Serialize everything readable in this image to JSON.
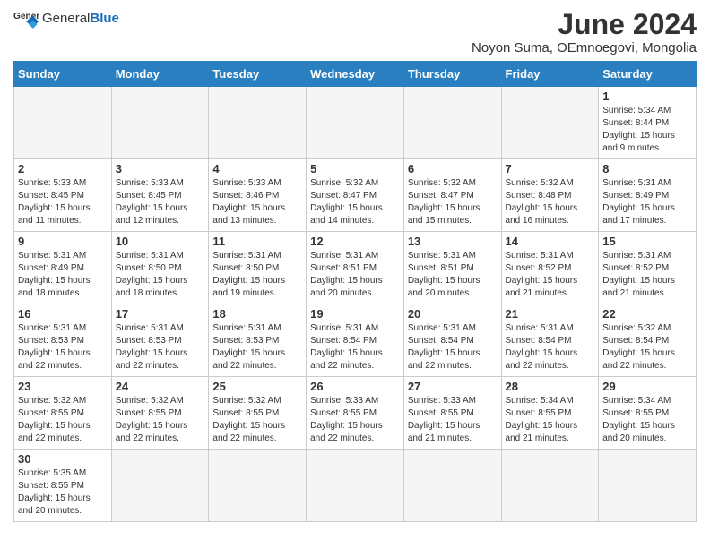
{
  "logo": {
    "text_general": "General",
    "text_blue": "Blue"
  },
  "title": "June 2024",
  "location": "Noyon Suma, OEmnoegovi, Mongolia",
  "weekdays": [
    "Sunday",
    "Monday",
    "Tuesday",
    "Wednesday",
    "Thursday",
    "Friday",
    "Saturday"
  ],
  "weeks": [
    [
      {
        "day": "",
        "info": ""
      },
      {
        "day": "",
        "info": ""
      },
      {
        "day": "",
        "info": ""
      },
      {
        "day": "",
        "info": ""
      },
      {
        "day": "",
        "info": ""
      },
      {
        "day": "",
        "info": ""
      },
      {
        "day": "1",
        "info": "Sunrise: 5:34 AM\nSunset: 8:44 PM\nDaylight: 15 hours and 9 minutes."
      }
    ],
    [
      {
        "day": "2",
        "info": "Sunrise: 5:33 AM\nSunset: 8:45 PM\nDaylight: 15 hours and 11 minutes."
      },
      {
        "day": "3",
        "info": "Sunrise: 5:33 AM\nSunset: 8:45 PM\nDaylight: 15 hours and 12 minutes."
      },
      {
        "day": "4",
        "info": "Sunrise: 5:33 AM\nSunset: 8:46 PM\nDaylight: 15 hours and 13 minutes."
      },
      {
        "day": "5",
        "info": "Sunrise: 5:32 AM\nSunset: 8:47 PM\nDaylight: 15 hours and 14 minutes."
      },
      {
        "day": "6",
        "info": "Sunrise: 5:32 AM\nSunset: 8:47 PM\nDaylight: 15 hours and 15 minutes."
      },
      {
        "day": "7",
        "info": "Sunrise: 5:32 AM\nSunset: 8:48 PM\nDaylight: 15 hours and 16 minutes."
      },
      {
        "day": "8",
        "info": "Sunrise: 5:31 AM\nSunset: 8:49 PM\nDaylight: 15 hours and 17 minutes."
      }
    ],
    [
      {
        "day": "9",
        "info": "Sunrise: 5:31 AM\nSunset: 8:49 PM\nDaylight: 15 hours and 18 minutes."
      },
      {
        "day": "10",
        "info": "Sunrise: 5:31 AM\nSunset: 8:50 PM\nDaylight: 15 hours and 18 minutes."
      },
      {
        "day": "11",
        "info": "Sunrise: 5:31 AM\nSunset: 8:50 PM\nDaylight: 15 hours and 19 minutes."
      },
      {
        "day": "12",
        "info": "Sunrise: 5:31 AM\nSunset: 8:51 PM\nDaylight: 15 hours and 20 minutes."
      },
      {
        "day": "13",
        "info": "Sunrise: 5:31 AM\nSunset: 8:51 PM\nDaylight: 15 hours and 20 minutes."
      },
      {
        "day": "14",
        "info": "Sunrise: 5:31 AM\nSunset: 8:52 PM\nDaylight: 15 hours and 21 minutes."
      },
      {
        "day": "15",
        "info": "Sunrise: 5:31 AM\nSunset: 8:52 PM\nDaylight: 15 hours and 21 minutes."
      }
    ],
    [
      {
        "day": "16",
        "info": "Sunrise: 5:31 AM\nSunset: 8:53 PM\nDaylight: 15 hours and 22 minutes."
      },
      {
        "day": "17",
        "info": "Sunrise: 5:31 AM\nSunset: 8:53 PM\nDaylight: 15 hours and 22 minutes."
      },
      {
        "day": "18",
        "info": "Sunrise: 5:31 AM\nSunset: 8:53 PM\nDaylight: 15 hours and 22 minutes."
      },
      {
        "day": "19",
        "info": "Sunrise: 5:31 AM\nSunset: 8:54 PM\nDaylight: 15 hours and 22 minutes."
      },
      {
        "day": "20",
        "info": "Sunrise: 5:31 AM\nSunset: 8:54 PM\nDaylight: 15 hours and 22 minutes."
      },
      {
        "day": "21",
        "info": "Sunrise: 5:31 AM\nSunset: 8:54 PM\nDaylight: 15 hours and 22 minutes."
      },
      {
        "day": "22",
        "info": "Sunrise: 5:32 AM\nSunset: 8:54 PM\nDaylight: 15 hours and 22 minutes."
      }
    ],
    [
      {
        "day": "23",
        "info": "Sunrise: 5:32 AM\nSunset: 8:55 PM\nDaylight: 15 hours and 22 minutes."
      },
      {
        "day": "24",
        "info": "Sunrise: 5:32 AM\nSunset: 8:55 PM\nDaylight: 15 hours and 22 minutes."
      },
      {
        "day": "25",
        "info": "Sunrise: 5:32 AM\nSunset: 8:55 PM\nDaylight: 15 hours and 22 minutes."
      },
      {
        "day": "26",
        "info": "Sunrise: 5:33 AM\nSunset: 8:55 PM\nDaylight: 15 hours and 22 minutes."
      },
      {
        "day": "27",
        "info": "Sunrise: 5:33 AM\nSunset: 8:55 PM\nDaylight: 15 hours and 21 minutes."
      },
      {
        "day": "28",
        "info": "Sunrise: 5:34 AM\nSunset: 8:55 PM\nDaylight: 15 hours and 21 minutes."
      },
      {
        "day": "29",
        "info": "Sunrise: 5:34 AM\nSunset: 8:55 PM\nDaylight: 15 hours and 20 minutes."
      }
    ],
    [
      {
        "day": "30",
        "info": "Sunrise: 5:35 AM\nSunset: 8:55 PM\nDaylight: 15 hours and 20 minutes."
      },
      {
        "day": "",
        "info": ""
      },
      {
        "day": "",
        "info": ""
      },
      {
        "day": "",
        "info": ""
      },
      {
        "day": "",
        "info": ""
      },
      {
        "day": "",
        "info": ""
      },
      {
        "day": "",
        "info": ""
      }
    ]
  ]
}
